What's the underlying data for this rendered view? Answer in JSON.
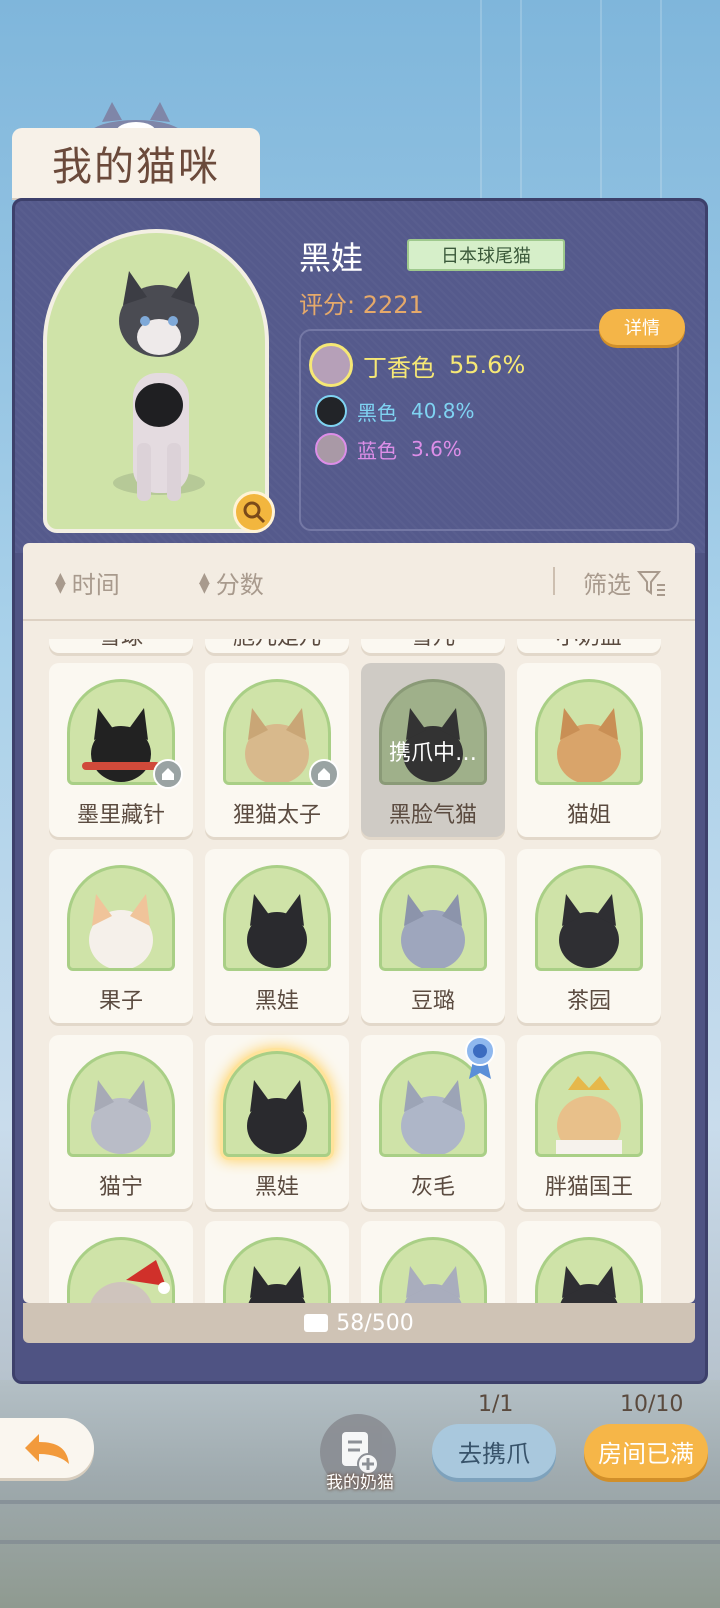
{
  "screen_title": "我的猫咪",
  "selected_cat": {
    "name": "黑娃",
    "breed": "日本球尾猫",
    "score_text": "评分: 2221",
    "detail_label": "详情",
    "colors": [
      {
        "name": "丁香色",
        "percent": "55.6%",
        "color": "#b6a0b8"
      },
      {
        "name": "黑色",
        "percent": "40.8%",
        "color": "#222428"
      },
      {
        "name": "蓝色",
        "percent": "3.6%",
        "color": "#a999a6"
      }
    ]
  },
  "sort": {
    "time_label": "时间",
    "score_label": "分数",
    "filter_label": "筛选"
  },
  "grid": {
    "partial_row": [
      "雪球",
      "胞儿是儿",
      "雪儿",
      "小奶盐"
    ],
    "cards": [
      {
        "name": "墨里藏针",
        "fur": "#222",
        "badge": "home"
      },
      {
        "name": "狸猫太子",
        "fur": "#d8b98c",
        "badge": "home"
      },
      {
        "name": "黑脸气猫",
        "fur": "#333",
        "overlay": "携爪中…"
      },
      {
        "name": "猫姐",
        "fur": "#d9a46a"
      },
      {
        "name": "果子",
        "fur": "#f0c49a"
      },
      {
        "name": "黑娃",
        "fur": "#2a2a2e"
      },
      {
        "name": "豆璐",
        "fur": "#9ea6bd"
      },
      {
        "name": "茶园",
        "fur": "#2f2f33"
      },
      {
        "name": "猫宁",
        "fur": "#b9bcc7"
      },
      {
        "name": "黑娃",
        "fur": "#2a2a2e",
        "selected": true
      },
      {
        "name": "灰毛",
        "fur": "#aeb6c8",
        "badge": "medal"
      },
      {
        "name": "胖猫国王",
        "fur": "#e8c08a"
      },
      {
        "name": "",
        "fur": "#cfc4bd"
      },
      {
        "name": "",
        "fur": "#2a2a2e"
      },
      {
        "name": "",
        "fur": "#a9adbd"
      },
      {
        "name": "",
        "fur": "#2f2f33"
      }
    ]
  },
  "capacity": "58/500",
  "bottom": {
    "milk_cat_label": "我的奶猫",
    "go_count": "1/1",
    "go_label": "去携爪",
    "room_count": "10/10",
    "room_label": "房间已满"
  }
}
